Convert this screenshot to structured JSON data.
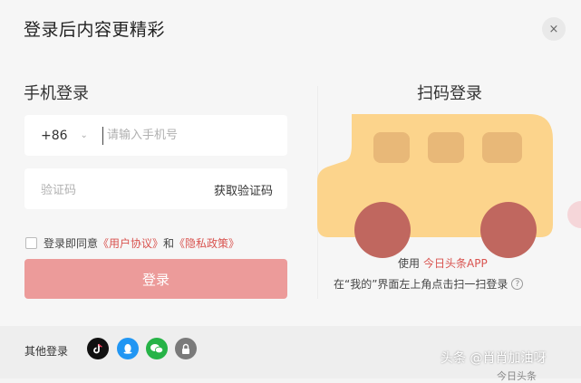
{
  "modal": {
    "title": "登录后内容更精彩",
    "close_icon": "×"
  },
  "phone_login": {
    "heading": "手机登录",
    "country_code": "+86",
    "phone_placeholder": "请输入手机号",
    "code_placeholder": "验证码",
    "get_code_label": "获取验证码",
    "agree_prefix": "登录即同意",
    "user_agreement": "《用户协议》",
    "and_text": "和",
    "privacy_policy": "《隐私政策》",
    "login_button": "登录"
  },
  "qr_login": {
    "heading": "扫码登录",
    "usage_prefix": "使用",
    "app_name": "今日头条APP",
    "hint": "在“我的”界面左上角点击扫一扫登录",
    "help_icon": "?"
  },
  "footer": {
    "other_login_label": "其他登录",
    "socials": [
      {
        "name": "douyin-icon",
        "color": "#111111"
      },
      {
        "name": "qq-icon",
        "color": "#2196f3"
      },
      {
        "name": "wechat-icon",
        "color": "#26b347"
      },
      {
        "name": "lock-icon",
        "color": "#7a7a7a"
      }
    ]
  },
  "overlay": {
    "watermark": "头条 @肖肖加油呀",
    "cut_text": "今日头条"
  },
  "colors": {
    "accent": "#d9534f",
    "login_button": "#ec9b9a",
    "bus_body": "#fcd48c",
    "bus_window": "#e8b878",
    "bus_wheel": "#c0675f"
  }
}
